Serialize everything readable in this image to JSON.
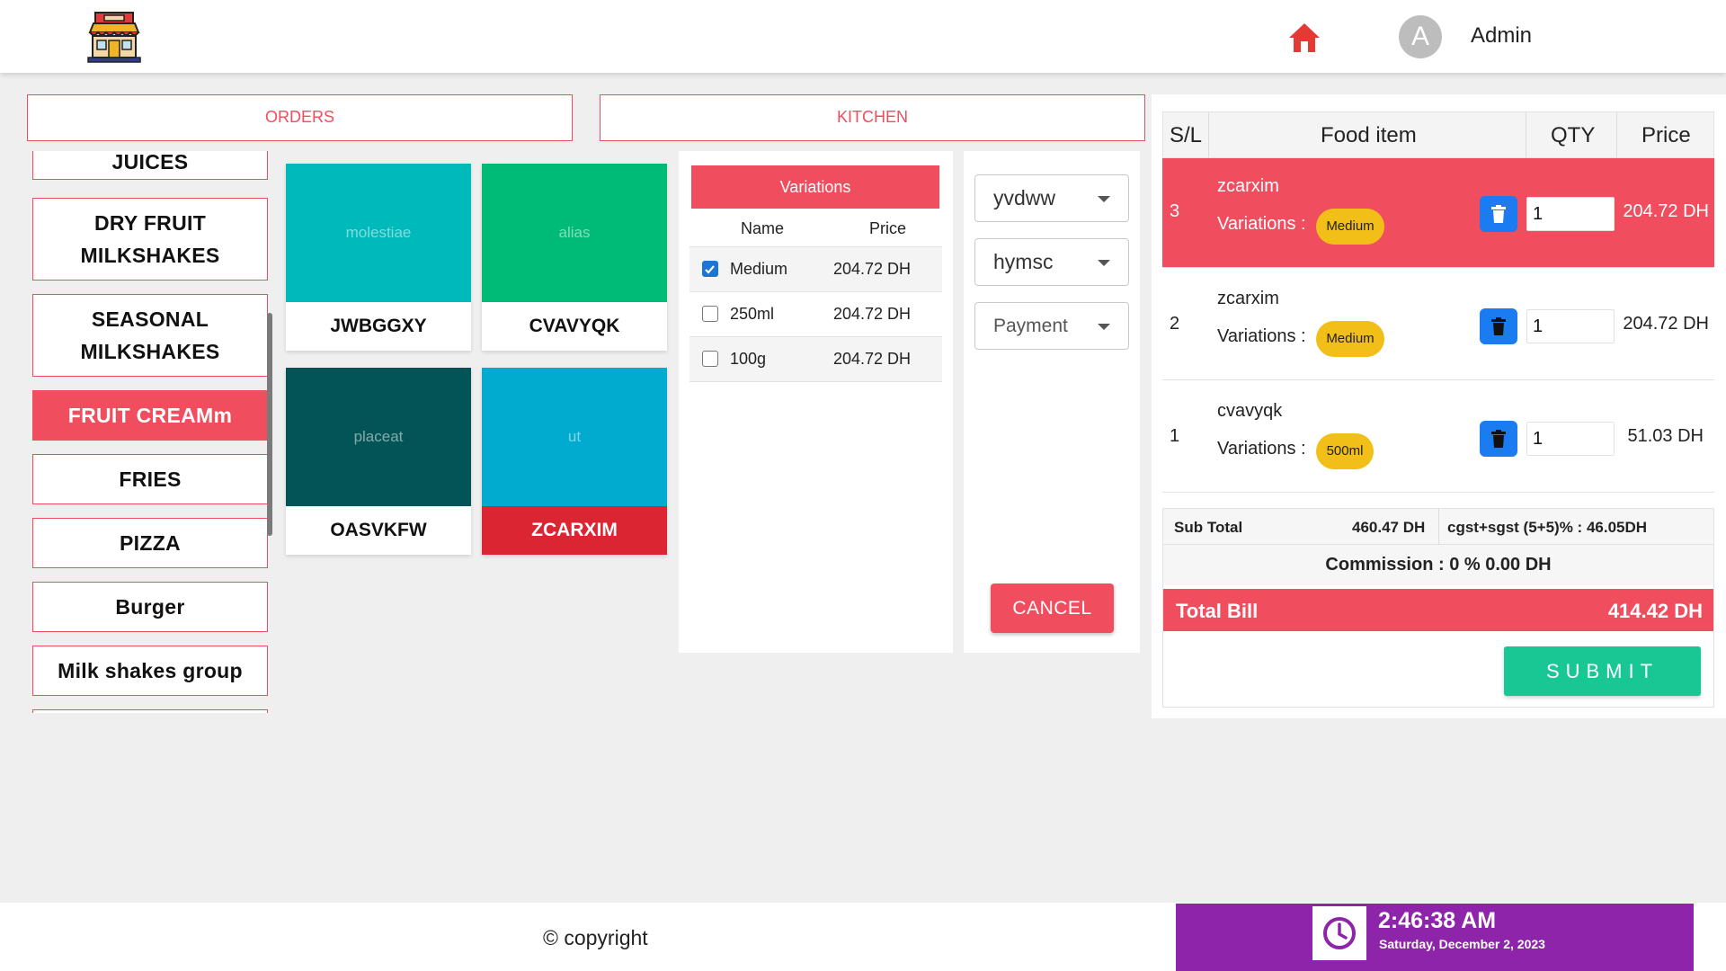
{
  "header": {
    "avatar_letter": "A",
    "user_name": "Admin"
  },
  "tabs": [
    {
      "label": "ORDERS"
    },
    {
      "label": "KITCHEN"
    }
  ],
  "categories": [
    {
      "label": "JUICES"
    },
    {
      "label": "DRY FRUIT MILKSHAKES"
    },
    {
      "label": "SEASONAL MILKSHAKES"
    },
    {
      "label": "FRUIT CREAMm",
      "active": true
    },
    {
      "label": "FRIES"
    },
    {
      "label": "PIZZA"
    },
    {
      "label": "Burger"
    },
    {
      "label": "Milk shakes group"
    }
  ],
  "products": [
    {
      "image_text": "molestiae",
      "name": "JWBGGXY",
      "color": "#00b9bb"
    },
    {
      "image_text": "alias",
      "name": "CVAVYQK",
      "color": "#00ba77"
    },
    {
      "image_text": "placeat",
      "name": "OASVKFW",
      "color": "#035456"
    },
    {
      "image_text": "ut",
      "name": "ZCARXIM",
      "color": "#01aacf",
      "selected": true
    }
  ],
  "variations": {
    "title": "Variations",
    "col_name": "Name",
    "col_price": "Price",
    "rows": [
      {
        "name": "Medium",
        "price": "204.72 DH",
        "checked": true
      },
      {
        "name": "250ml",
        "price": "204.72 DH",
        "checked": false
      },
      {
        "name": "100g",
        "price": "204.72 DH",
        "checked": false
      }
    ]
  },
  "selects": [
    {
      "value": "yvdww"
    },
    {
      "value": "hymsc"
    },
    {
      "value": "Payment",
      "placeholder": true
    }
  ],
  "cancel_label": "CANCEL",
  "cart": {
    "headers": {
      "sl": "S/L",
      "food": "Food item",
      "qty": "QTY",
      "price": "Price"
    },
    "rows": [
      {
        "sl": "3",
        "name": "zcarxim",
        "variations_label": "Variations :",
        "variation": "Medium",
        "qty": "1",
        "price": "204.72 DH",
        "highlighted": true
      },
      {
        "sl": "2",
        "name": "zcarxim",
        "variations_label": "Variations :",
        "variation": "Medium",
        "qty": "1",
        "price": "204.72 DH"
      },
      {
        "sl": "1",
        "name": "cvavyqk",
        "variations_label": "Variations :",
        "variation": "500ml",
        "qty": "1",
        "price": "51.03 DH"
      }
    ],
    "subtotal_label": "Sub Total",
    "subtotal_value": "460.47 DH",
    "tax_text": "cgst+sgst (5+5)% : 46.05DH",
    "commission_text": "Commission :  0 % 0.00 DH",
    "total_label": "Total Bill",
    "total_value": "414.42 DH",
    "submit_label": "SUBMIT"
  },
  "footer": {
    "copyright": "© copyright",
    "time": "2:46:38 AM",
    "date": "Saturday, December 2, 2023"
  },
  "colors": {
    "accent": "#f04d5e",
    "selected_product": "#dc2532",
    "submit": "#18c794",
    "delete_button": "#1a7cf0",
    "badge": "#f2be18",
    "clock_bg": "#8e24aa",
    "home_icon": "#e53935"
  }
}
